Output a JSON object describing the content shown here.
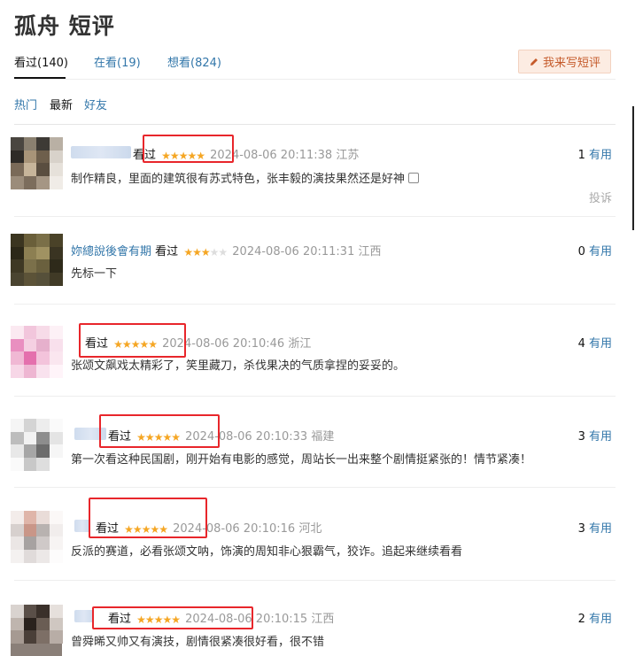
{
  "page": {
    "title": "孤舟 短评",
    "write_button": "我来写短评"
  },
  "tabs": [
    {
      "label": "看过(140)",
      "active": true
    },
    {
      "label": "在看(19)",
      "active": false
    },
    {
      "label": "想看(824)",
      "active": false
    }
  ],
  "filters": [
    {
      "label": "热门"
    },
    {
      "label": "最新"
    },
    {
      "label": "好友"
    }
  ],
  "colors": {
    "link": "#3377aa",
    "star": "#f5a623",
    "highlight_box": "#e8262b",
    "button_bg": "#fcece2"
  },
  "comments": [
    {
      "user": "",
      "status": "看过",
      "stars": 5,
      "datetime": "2024-08-06 20:11:38",
      "location": "江苏",
      "text": "制作精良，里面的建筑很有苏式特色，张丰毅的演技果然还是好神",
      "useful_count": "1",
      "useful_label": "有用",
      "report": "投诉"
    },
    {
      "user": "妳總說後會有期",
      "status": "看过",
      "stars": 3,
      "datetime": "2024-08-06 20:11:31",
      "location": "江西",
      "text": "先标一下",
      "useful_count": "0",
      "useful_label": "有用"
    },
    {
      "user": "",
      "status": "看过",
      "stars": 5,
      "datetime": "2024-08-06 20:10:46",
      "location": "浙江",
      "text": "张颂文飙戏太精彩了，笑里藏刀，杀伐果决的气质拿捏的妥妥的。",
      "useful_count": "4",
      "useful_label": "有用"
    },
    {
      "user": "",
      "status": "看过",
      "stars": 5,
      "datetime": "2024-08-06 20:10:33",
      "location": "福建",
      "text": "第一次看这种民国剧，刚开始有电影的感觉，周站长一出来整个剧情挺紧张的！情节紧凑！",
      "useful_count": "3",
      "useful_label": "有用"
    },
    {
      "user": "",
      "status": "看过",
      "stars": 5,
      "datetime": "2024-08-06 20:10:16",
      "location": "河北",
      "text": "反派的赛道，必看张颂文呐，饰演的周知非心狠霸气，狡诈。追起来继续看看",
      "useful_count": "3",
      "useful_label": "有用"
    },
    {
      "user": "",
      "status": "看过",
      "stars": 5,
      "datetime": "2024-08-06 20:10:15",
      "location": "江西",
      "text": "曾舜晞又帅又有演技，剧情很紧凑很好看，很不错",
      "useful_count": "2",
      "useful_label": "有用"
    }
  ]
}
